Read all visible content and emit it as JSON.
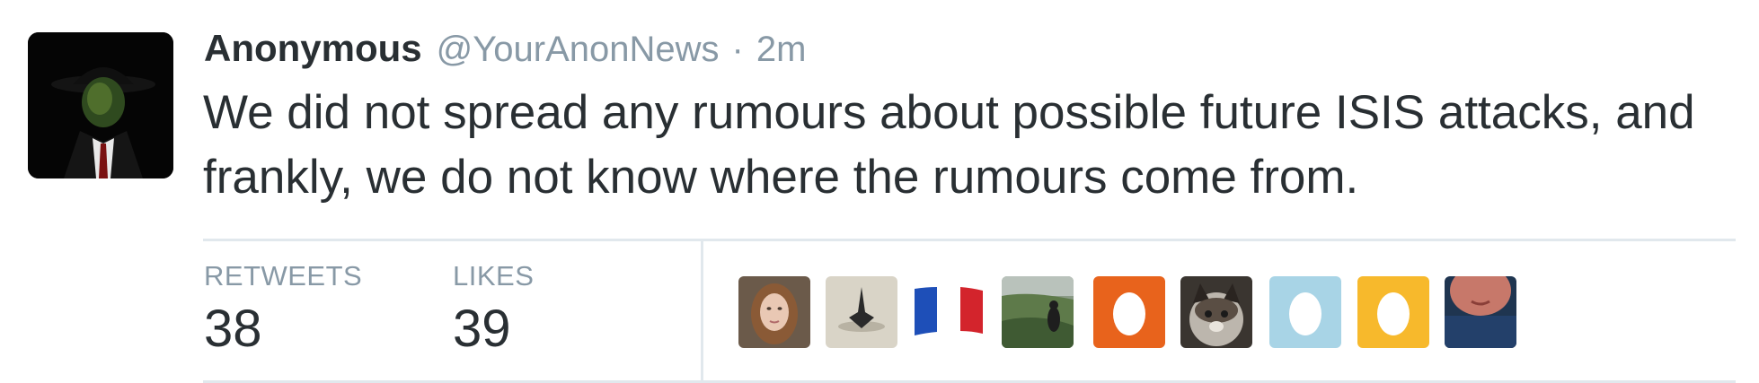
{
  "tweet": {
    "author_name": "Anonymous",
    "handle": "@YourAnonNews",
    "separator": "·",
    "time": "2m",
    "text": "We did not spread any rumours about possible future ISIS attacks, and frankly, we do not know where the rumours come from."
  },
  "stats": {
    "retweets_label": "RETWEETS",
    "retweets_count": "38",
    "likes_label": "LIKES",
    "likes_count": "39"
  },
  "likers": [
    {
      "kind": "photo-woman"
    },
    {
      "kind": "photo-spinning-top"
    },
    {
      "kind": "french-flag"
    },
    {
      "kind": "photo-landscape"
    },
    {
      "kind": "default-egg",
      "color": "#e8631c"
    },
    {
      "kind": "photo-cat"
    },
    {
      "kind": "default-egg",
      "color": "#a8d4e6"
    },
    {
      "kind": "default-egg",
      "color": "#f7b92c"
    },
    {
      "kind": "photo-face"
    }
  ],
  "colors": {
    "text": "#292f33",
    "muted": "#8899a6",
    "divider": "#e1e8ed"
  }
}
